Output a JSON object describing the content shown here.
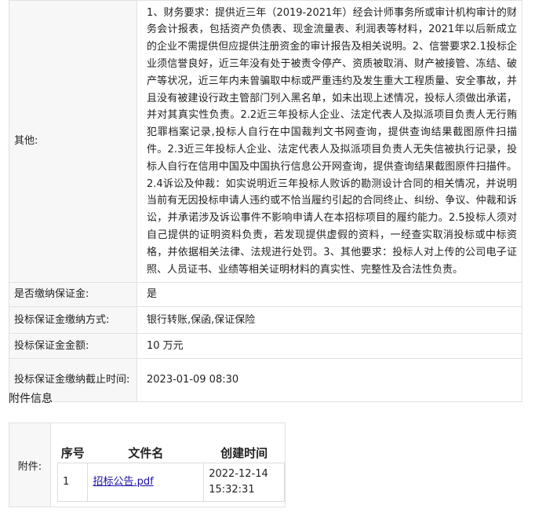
{
  "details": {
    "other": {
      "label": "其他:",
      "value": "1、财务要求：提供近三年（2019-2021年）经会计师事务所或审计机构审计的财务会计报表，包括资产负债表、现金流量表、利润表等材料，2021年以后新成立的企业不需提供但应提供注册资金的审计报告及相关说明。2、信誉要求2.1投标企业须信誉良好，近三年没有处于被责令停产、资质被取消、财产被接管、冻结、破产等状况，近三年内未曾骗取中标或严重违约及发生重大工程质量、安全事故，并且没有被建设行政主管部门列入黑名单，如未出现上述情况，投标人须做出承诺，并对其真实性负责。2.2近三年投标人企业、法定代表人及拟派项目负责人无行贿犯罪档案记录,投标人自行在中国裁判文书网查询，提供查询结果截图原件扫描件。2.3近三年投标人企业、法定代表人及拟派项目负责人无失信被执行记录，投标人自行在信用中国及中国执行信息公开网查询，提供查询结果截图原件扫描件。2.4诉讼及仲裁：如实说明近三年投标人败诉的勘测设计合同的相关情况，并说明当前有无因投标申请人违约或不恰当履约引起的合同终止、纠纷、争议、仲裁和诉讼，并承诺涉及诉讼事件不影响申请人在本招标项目的履约能力。2.5投标人须对自己提供的证明资料负责，若发现提供虚假的资料，一经查实取消投标或中标资格，并依据相关法律、法规进行处罚。3、其他要求：投标人对上传的公司电子证照、人员证书、业绩等相关证明材料的真实性、完整性及合法性负责。"
    },
    "deposit_required": {
      "label": "是否缴纳保证金:",
      "value": "是"
    },
    "deposit_method": {
      "label": "投标保证金缴纳方式:",
      "value": "银行转账,保函,保证保险"
    },
    "deposit_amount": {
      "label": "投标保证金金额:",
      "value": "10 万元"
    },
    "deposit_deadline": {
      "label": "投标保证金缴纳截止时间:",
      "value": "2023-01-09 08:30"
    }
  },
  "attachments": {
    "section_title": "附件信息",
    "label": "附件:",
    "headers": {
      "index": "序号",
      "filename": "文件名",
      "created": "创建时间"
    },
    "rows": [
      {
        "index": "1",
        "filename": "招标公告.pdf",
        "created": "2022-12-14\n15:32:31"
      }
    ]
  }
}
